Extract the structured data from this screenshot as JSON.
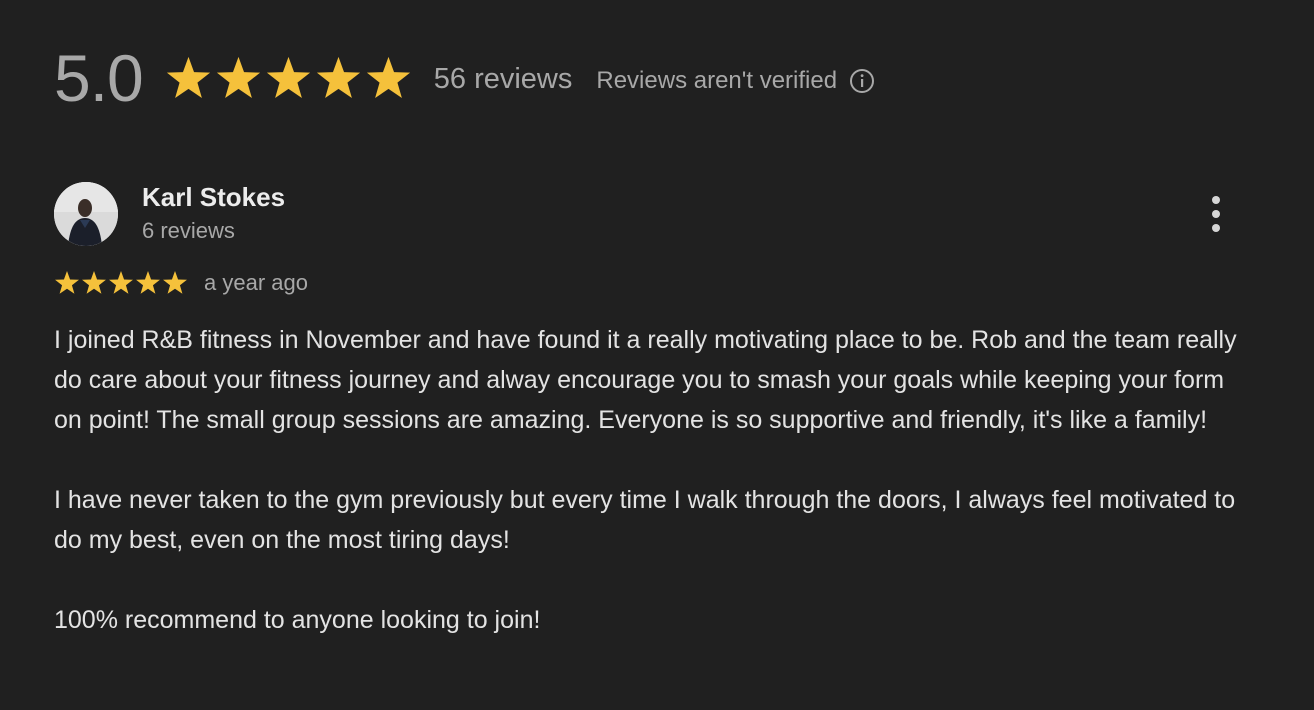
{
  "summary": {
    "rating": "5.0",
    "rating_value": 5,
    "max_rating": 5,
    "review_count_label": "56 reviews",
    "verification_note": "Reviews aren't verified",
    "star_color": "#f5c13b",
    "info_icon": "info-icon"
  },
  "review": {
    "reviewer_name": "Karl Stokes",
    "reviewer_review_count": "6 reviews",
    "rating_value": 5,
    "max_rating": 5,
    "date": "a year ago",
    "menu_icon": "more-vertical-icon",
    "paragraphs": [
      "I joined R&B fitness in November and have found it a really motivating place to be. Rob and the team really do care about your fitness journey and alway encourage you to smash your goals while keeping your form on point! The small group sessions are amazing. Everyone is so supportive and friendly, it's like a family!",
      "I have never taken to the gym previously but every time I walk through the doors, I always feel motivated to do my best, even on the most tiring days!",
      "100% recommend to anyone looking to join!"
    ]
  },
  "colors": {
    "background": "#202020",
    "primary_text": "#e3e3e3",
    "secondary_text": "#a8a8a8",
    "star": "#f5c13b"
  }
}
